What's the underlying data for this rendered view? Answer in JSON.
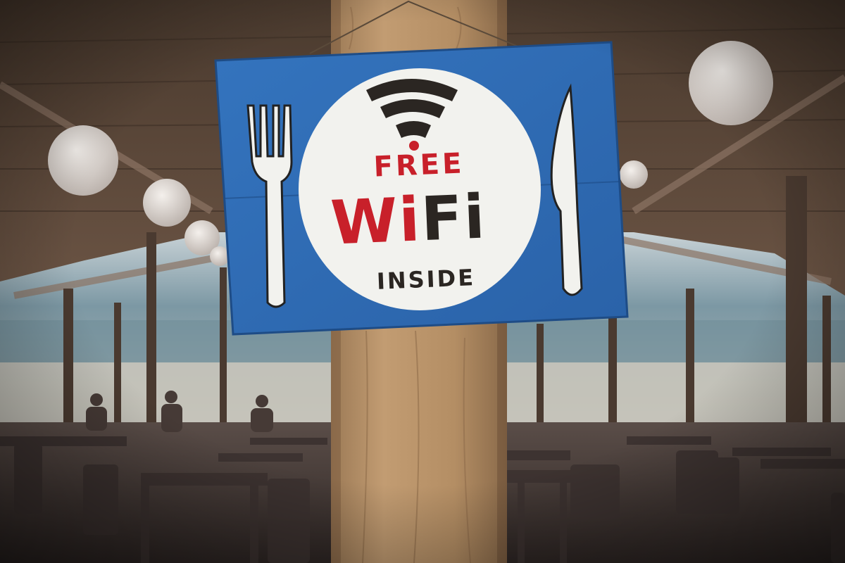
{
  "sign": {
    "line1": "FREE",
    "line2_wi": "Wi",
    "line2_fi": "Fi",
    "line3": "INSIDE"
  },
  "colors": {
    "sign_blue": "#2f6db8",
    "plate_white": "#f2f2ee",
    "text_red": "#c8202a",
    "text_dark": "#2b2622",
    "wood_post": "#b08a62"
  },
  "icons": [
    "wifi-icon",
    "fork-icon",
    "knife-icon"
  ]
}
